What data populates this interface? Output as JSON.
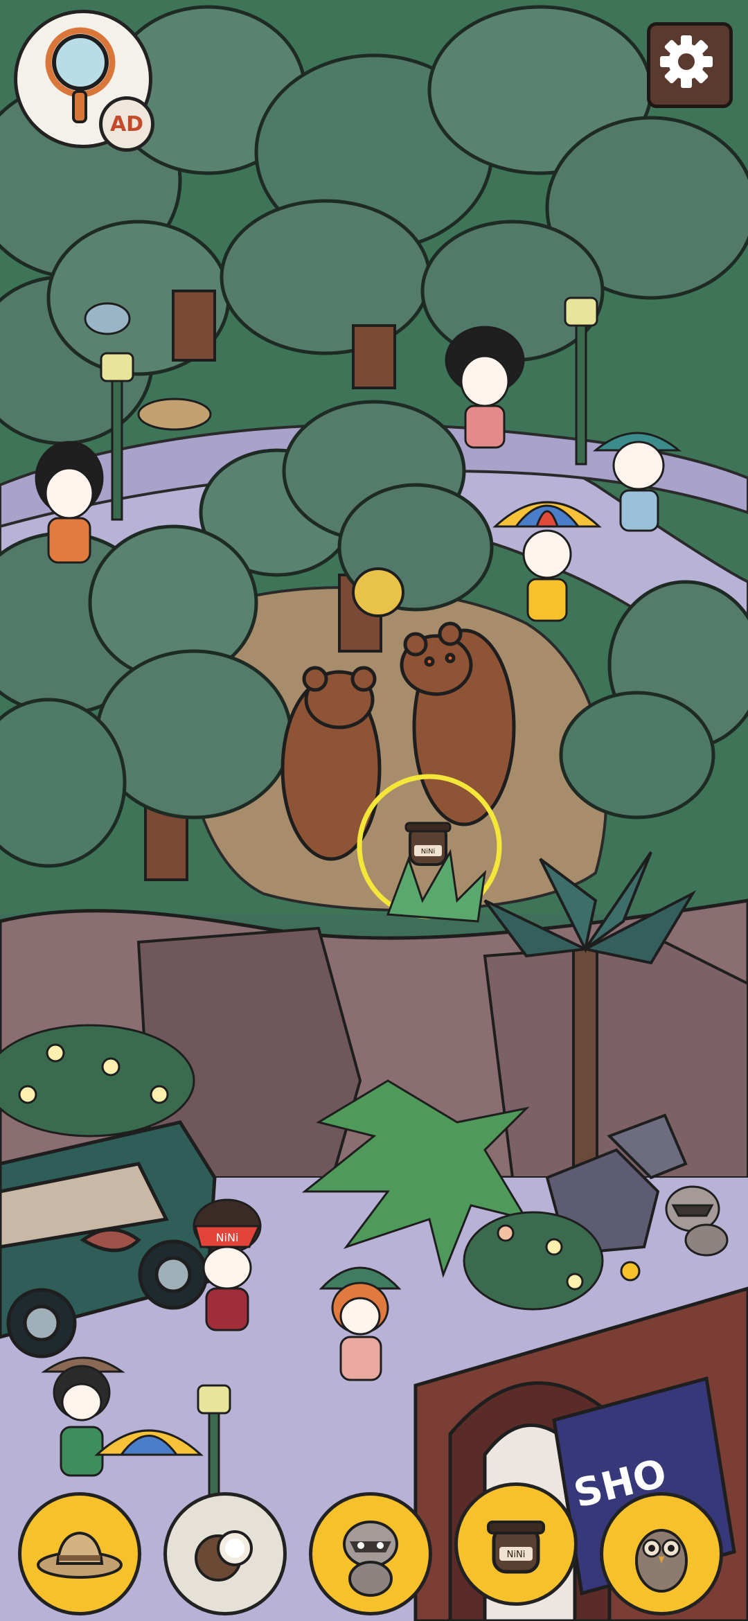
{
  "game": {
    "hint_button": {
      "icon": "magnifier-icon",
      "ad_label": "AD"
    },
    "settings_button": {
      "icon": "gear-icon"
    },
    "scene": {
      "honey_pot_label": "NiNi",
      "cap_label": "NiNi",
      "shop_sign": "SHO",
      "highlight_ring_color": "#f5e73a"
    },
    "item_bar": {
      "slots": [
        {
          "name": "safari-hat",
          "icon": "safari-hat-icon",
          "state": "target"
        },
        {
          "name": "coconut",
          "icon": "coconut-icon",
          "state": "found"
        },
        {
          "name": "raccoon",
          "icon": "raccoon-icon",
          "state": "target"
        },
        {
          "name": "honey-pot",
          "icon": "honey-pot-icon",
          "state": "target",
          "label": "NiNi"
        },
        {
          "name": "owl",
          "icon": "owl-icon",
          "state": "target"
        }
      ]
    }
  }
}
